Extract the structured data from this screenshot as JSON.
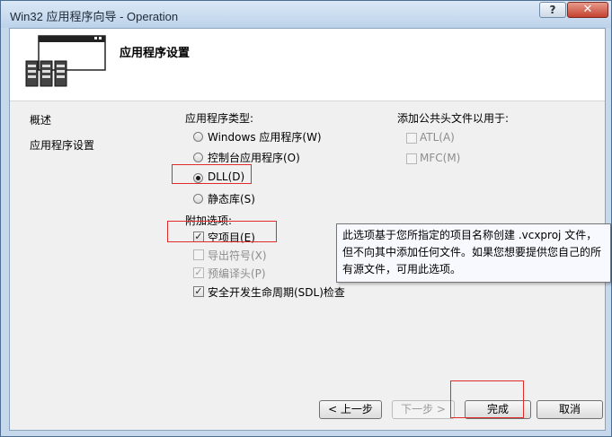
{
  "window": {
    "title": "Win32 应用程序向导 - Operation",
    "help_label": "?",
    "close_label": "✕"
  },
  "header": {
    "title": "应用程序设置"
  },
  "nav": {
    "items": [
      "概述",
      "应用程序设置"
    ]
  },
  "app_type": {
    "label": "应用程序类型:",
    "options": [
      {
        "label": "Windows 应用程序(W)",
        "checked": false
      },
      {
        "label": "控制台应用程序(O)",
        "checked": false
      },
      {
        "label": "DLL(D)",
        "checked": true
      },
      {
        "label": "静态库(S)",
        "checked": false
      }
    ]
  },
  "common_headers": {
    "label": "添加公共头文件以用于:",
    "options": [
      {
        "label": "ATL(A)",
        "checked": false
      },
      {
        "label": "MFC(M)",
        "checked": false
      }
    ]
  },
  "extra": {
    "label": "附加选项:",
    "options": [
      {
        "label": "空项目(E)",
        "checked": true
      },
      {
        "label": "导出符号(X)",
        "checked": false
      },
      {
        "label": "预编译头(P)",
        "checked": true
      },
      {
        "label": "安全开发生命周期(SDL)检查",
        "checked": true
      }
    ]
  },
  "tooltip": {
    "lines": [
      "此选项基于您所指定的项目名称创建 .vcxproj 文件，",
      "但不向其中添加任何文件。如果您想要提供您自己的所",
      "有源文件，可用此选项。"
    ]
  },
  "buttons": {
    "prev": "< 上一步",
    "next": "下一步 >",
    "finish": "完成",
    "cancel": "取消"
  },
  "colors": {
    "highlight_box": "#e12b2b",
    "window_frame": "#c6d8ec"
  }
}
